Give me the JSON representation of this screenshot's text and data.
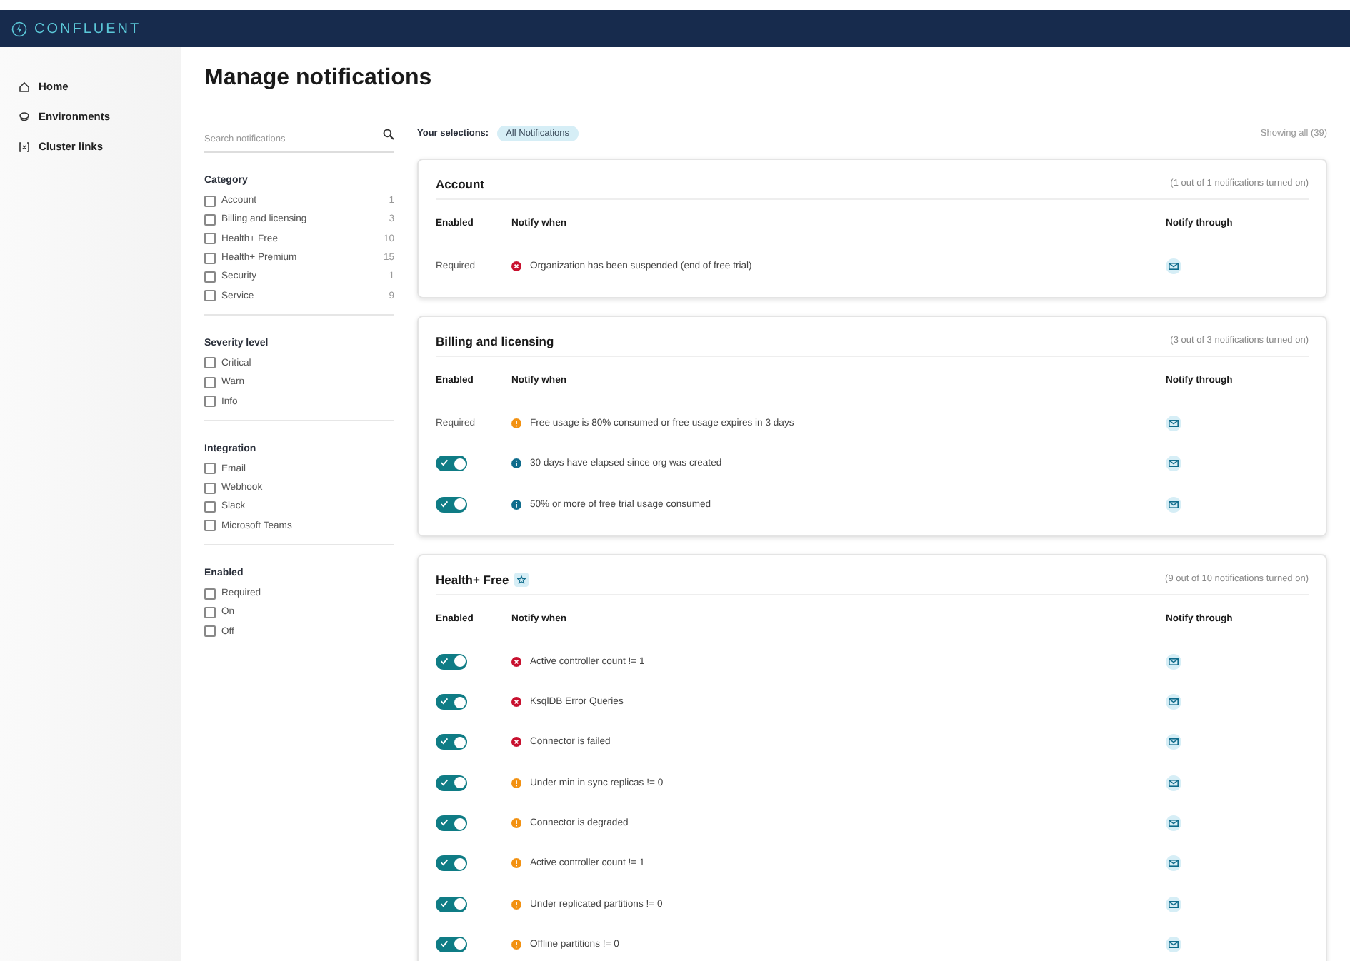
{
  "header": {
    "logo": "CONFLUENT"
  },
  "nav": {
    "items": [
      {
        "label": "Home",
        "selected": false
      },
      {
        "label": "Environments",
        "selected": false
      },
      {
        "label": "Cluster links",
        "selected": false
      }
    ]
  },
  "title": "Manage notifications",
  "search": {
    "placeholder": "Search notifications"
  },
  "filters": [
    {
      "title": "Category",
      "options": [
        {
          "label": "Account",
          "count": "1",
          "checked": false
        },
        {
          "label": "Billing and licensing",
          "count": "3",
          "checked": false
        },
        {
          "label": "Health+ Free",
          "count": "10",
          "checked": false
        },
        {
          "label": "Health+ Premium",
          "count": "15",
          "checked": false
        },
        {
          "label": "Security",
          "count": "1",
          "checked": false
        },
        {
          "label": "Service",
          "count": "9",
          "checked": false
        }
      ]
    },
    {
      "title": "Severity level",
      "options": [
        {
          "label": "Critical",
          "checked": false
        },
        {
          "label": "Warn",
          "checked": false
        },
        {
          "label": "Info",
          "checked": false
        }
      ]
    },
    {
      "title": "Integration",
      "options": [
        {
          "label": "Email",
          "checked": false
        },
        {
          "label": "Webhook",
          "checked": false
        },
        {
          "label": "Slack",
          "checked": false
        },
        {
          "label": "Microsoft Teams",
          "checked": false
        }
      ]
    },
    {
      "title": "Enabled",
      "options": [
        {
          "label": "Required",
          "checked": false
        },
        {
          "label": "On",
          "checked": false
        },
        {
          "label": "Off",
          "checked": false
        }
      ]
    }
  ],
  "selections": {
    "label": "Your selections:",
    "chips": [
      "All Notifications"
    ],
    "showing": "Showing all (39)"
  },
  "sections": [
    {
      "title": "Account",
      "badge": false,
      "summary": "(1 out of 1 notifications turned on)",
      "columns": [
        "Enabled",
        "Notify when",
        "Notify through"
      ],
      "rows": [
        {
          "kind": "required",
          "enabled_text": "Required",
          "alert": {
            "kind": "error"
          },
          "text": "Organization has been suspended (end of free trial)"
        }
      ]
    },
    {
      "title": "Billing and licensing",
      "badge": false,
      "summary": "(3 out of 3 notifications turned on)",
      "columns": [
        "Enabled",
        "Notify when",
        "Notify through"
      ],
      "rows": [
        {
          "kind": "required",
          "enabled_text": "Required",
          "alert": {
            "kind": "warning"
          },
          "text": "Free usage is 80% consumed or free usage expires in 3 days"
        },
        {
          "kind": "toggle",
          "on": true,
          "alert": {
            "kind": "info"
          },
          "text": "30 days have elapsed since org was created"
        },
        {
          "kind": "toggle",
          "on": true,
          "alert": {
            "kind": "info"
          },
          "text": "50% or more of free trial usage consumed"
        }
      ]
    },
    {
      "title": "Health+ Free",
      "badge": true,
      "summary": "(9 out of 10 notifications turned on)",
      "columns": [
        "Enabled",
        "Notify when",
        "Notify through"
      ],
      "rows": [
        {
          "kind": "toggle",
          "on": true,
          "alert": {
            "kind": "error"
          },
          "text": "Active controller count != 1"
        },
        {
          "kind": "toggle",
          "on": true,
          "alert": {
            "kind": "error"
          },
          "text": "KsqlDB Error Queries"
        },
        {
          "kind": "toggle",
          "on": true,
          "alert": {
            "kind": "error"
          },
          "text": "Connector is failed"
        },
        {
          "kind": "toggle",
          "on": true,
          "alert": {
            "kind": "warning"
          },
          "text": "Under min in sync replicas != 0"
        },
        {
          "kind": "toggle",
          "on": true,
          "alert": {
            "kind": "warning"
          },
          "text": "Connector is degraded"
        },
        {
          "kind": "toggle",
          "on": true,
          "alert": {
            "kind": "warning"
          },
          "text": "Active controller count != 1"
        },
        {
          "kind": "toggle",
          "on": true,
          "alert": {
            "kind": "warning"
          },
          "text": "Under replicated partitions != 0"
        },
        {
          "kind": "toggle",
          "on": true,
          "alert": {
            "kind": "warning"
          },
          "text": "Offline partitions != 0"
        }
      ]
    }
  ]
}
